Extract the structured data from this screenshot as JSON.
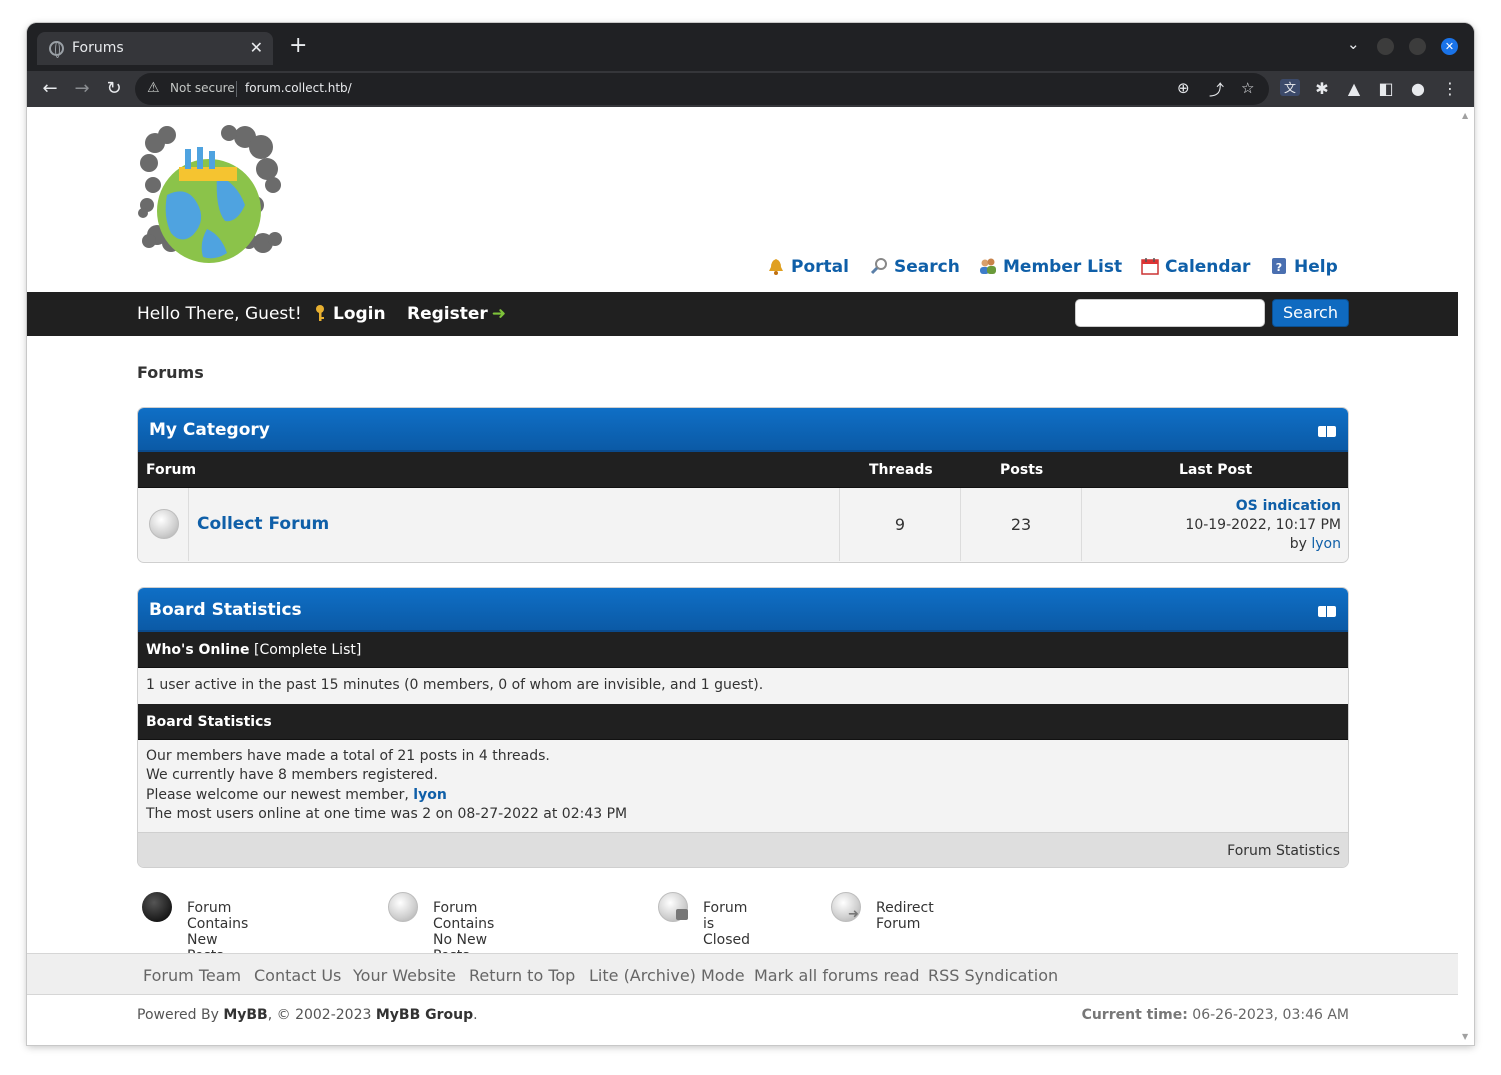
{
  "browser": {
    "tab_title": "Forums",
    "security_label": "Not secure",
    "url": "forum.collect.htb/"
  },
  "header": {
    "menu": [
      {
        "label": "Portal",
        "icon": "bell-icon"
      },
      {
        "label": "Search",
        "icon": "magnifier-icon"
      },
      {
        "label": "Member List",
        "icon": "members-icon"
      },
      {
        "label": "Calendar",
        "icon": "calendar-icon"
      },
      {
        "label": "Help",
        "icon": "help-icon"
      }
    ]
  },
  "panel": {
    "greeting": "Hello There, Guest!",
    "login_label": "Login",
    "register_label": "Register",
    "search_button": "Search",
    "search_value": ""
  },
  "breadcrumb": "Forums",
  "category": {
    "title": "My Category",
    "columns": {
      "forum": "Forum",
      "threads": "Threads",
      "posts": "Posts",
      "last_post": "Last Post"
    },
    "forums": [
      {
        "name": "Collect Forum",
        "threads": "9",
        "posts": "23",
        "last_post_title": "OS indication",
        "last_post_date": "10-19-2022, 10:17 PM",
        "last_post_by": "by",
        "last_post_user": "lyon"
      }
    ]
  },
  "stats": {
    "title": "Board Statistics",
    "whos_online_label": "Who's Online",
    "complete_list_label": "[Complete List]",
    "online_text": "1 user active in the past 15 minutes (0 members, 0 of whom are invisible, and 1 guest).",
    "section_label": "Board Statistics",
    "line1": "Our members have made a total of 21 posts in 4 threads.",
    "line2": "We currently have 8 members registered.",
    "line3_prefix": "Please welcome our newest member,",
    "newest_member": "lyon",
    "line4": "The most users online at one time was 2 on 08-27-2022 at 02:43 PM",
    "footer_link": "Forum Statistics"
  },
  "legend": [
    {
      "label": "Forum Contains New Posts",
      "icon": "new-posts-icon"
    },
    {
      "label": "Forum Contains No New Posts",
      "icon": "no-new-posts-icon"
    },
    {
      "label": "Forum is Closed",
      "icon": "forum-closed-icon"
    },
    {
      "label": "Redirect Forum",
      "icon": "redirect-forum-icon"
    }
  ],
  "footer": {
    "links": [
      "Forum Team",
      "Contact Us",
      "Your Website",
      "Return to Top",
      "Lite (Archive) Mode",
      "Mark all forums read",
      "RSS Syndication"
    ],
    "powered_prefix": "Powered By",
    "powered_mybb": "MyBB",
    "copyright_mid": ", © 2002-2023",
    "mybb_group": "MyBB Group",
    "current_time_label": "Current time:",
    "current_time_value": "06-26-2023, 03:46 AM"
  },
  "colors": {
    "accent": "#0f6ac0",
    "link": "#0f5fa8",
    "panel": "#202020"
  }
}
